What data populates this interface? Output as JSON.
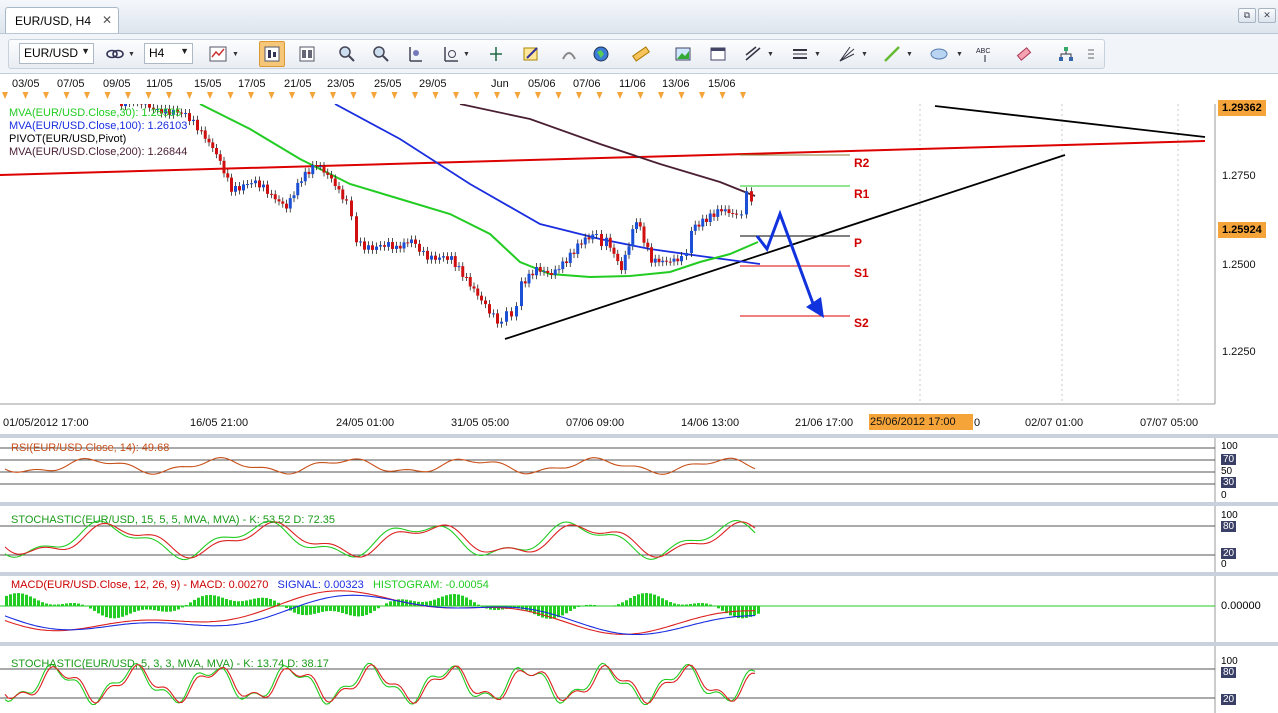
{
  "tab": {
    "title": "EUR/USD, H4",
    "close": "✕"
  },
  "window_buttons": [
    "⧉",
    "✕"
  ],
  "toolbar": {
    "symbol": "EUR/USD",
    "timeframe": "H4",
    "symbol_arrow": "▼",
    "timeframe_arrow": "▼"
  },
  "top_dates": [
    "03/05",
    "07/05",
    "09/05",
    "11/05",
    "15/05",
    "17/05",
    "21/05",
    "23/05",
    "25/05",
    "29/05",
    "Jun",
    "05/06",
    "07/06",
    "11/06",
    "13/06",
    "15/06"
  ],
  "bottom_dates": [
    "01/05/2012 17:00",
    "16/05 21:00",
    "24/05 01:00",
    "31/05 05:00",
    "07/06 09:00",
    "14/06 13:00",
    "21/06 17:00",
    "02/07 01:00",
    "07/07 05:00"
  ],
  "highlight_date": "25/06/2012 17:00",
  "highlight_date_tail": "0",
  "legend": {
    "ma30": "MVA(EUR/USD.Close,30): 1.25595",
    "ma100": "MVA(EUR/USD.Close,100): 1.26103",
    "pivot": "PIVOT(EUR/USD,Pivot)",
    "ma200": "MVA(EUR/USD.Close,200): 1.26844"
  },
  "price_axis": [
    "1.2750",
    "1.2500",
    "1.2250"
  ],
  "price_badge_top": "1.29362",
  "price_badge_current": "1.25924",
  "pivot_labels": {
    "r2": "R2",
    "r1": "R1",
    "p": "P",
    "s1": "S1",
    "s2": "S2"
  },
  "rsi": {
    "title": "RSI(EUR/USD.Close, 14): 49.68",
    "scale": [
      "100",
      "70",
      "50",
      "30",
      "0"
    ]
  },
  "stoch1": {
    "title": "STOCHASTIC(EUR/USD, 15, 5, 5, MVA, MVA) -  K: 53.52  D: 72.35",
    "scale": [
      "100",
      "80",
      "20",
      "0"
    ]
  },
  "macd": {
    "title_main": "MACD(EUR/USD.Close, 12, 26, 9) -  MACD: 0.00270",
    "title_signal": "SIGNAL: 0.00323",
    "title_hist": "HISTOGRAM: -0.00054",
    "scale": "0.00000"
  },
  "stoch2": {
    "title": "STOCHASTIC(EUR/USD, 5, 3, 3, MVA, MVA) -  K: 13.74  D: 38.17",
    "scale": [
      "100",
      "80",
      "20"
    ]
  },
  "colors": {
    "ma30": "#22cc22",
    "ma100": "#1a2ee0",
    "ma200": "#4a1f33",
    "pivot_trend": "#dd0000",
    "arrow": "#1133dd",
    "badge_orange": "#f5a43a"
  }
}
